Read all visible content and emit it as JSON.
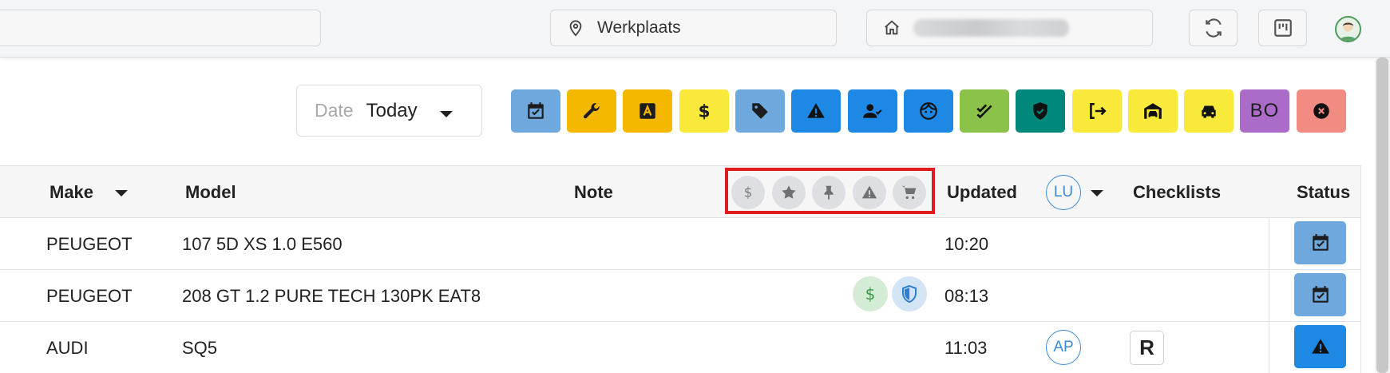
{
  "topbar": {
    "search_placeholder": "",
    "location": "Werkplaats",
    "company_blurred": true
  },
  "date": {
    "label": "Date",
    "value": "Today"
  },
  "filters": [
    {
      "name": "calendar-check",
      "bg": "#6fa8dc"
    },
    {
      "name": "wrench",
      "bg": "#f5b800"
    },
    {
      "name": "a-badge",
      "bg": "#f5b800"
    },
    {
      "name": "dollar",
      "bg": "#f9e93a"
    },
    {
      "name": "tag",
      "bg": "#6fa8dc"
    },
    {
      "name": "warning",
      "bg": "#1e88e5"
    },
    {
      "name": "user-check",
      "bg": "#1e88e5"
    },
    {
      "name": "face",
      "bg": "#1e88e5"
    },
    {
      "name": "double-check",
      "bg": "#8bc34a"
    },
    {
      "name": "shield-check",
      "bg": "#00897b"
    },
    {
      "name": "exit",
      "bg": "#f9e93a"
    },
    {
      "name": "garage",
      "bg": "#f9e93a"
    },
    {
      "name": "car",
      "bg": "#f9e93a"
    },
    {
      "name": "bo-text",
      "bg": "#ab6cc9",
      "label": "BO"
    },
    {
      "name": "cancel",
      "bg": "#f28b82"
    }
  ],
  "table": {
    "headers": {
      "make": "Make",
      "model": "Model",
      "note": "Note",
      "updated": "Updated",
      "user": "LU",
      "checklists": "Checklists",
      "status": "Status"
    },
    "rows": [
      {
        "make": "PEUGEOT",
        "model": "107 5D XS 1.0 E560",
        "updated": "10:20",
        "user": "",
        "checklist": "",
        "status": "calendar-check"
      },
      {
        "make": "PEUGEOT",
        "model": "208 GT 1.2 PURE TECH 130PK EAT8",
        "updated": "08:13",
        "user": "",
        "checklist": "",
        "status": "calendar-check"
      },
      {
        "make": "AUDI",
        "model": "SQ5",
        "updated": "11:03",
        "user": "AP",
        "checklist": "R",
        "status": "warning"
      }
    ]
  },
  "colors": {
    "calendar": "#6fa8dc",
    "warning_blue": "#1e88e5",
    "highlight": "#e01b1b"
  }
}
